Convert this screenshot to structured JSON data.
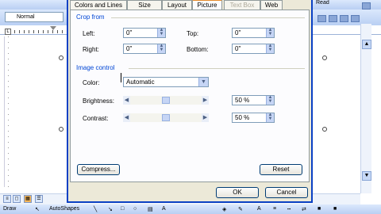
{
  "word": {
    "style_value": "Normal",
    "read_label": "Read",
    "ruler_tab_label": "L"
  },
  "dialog": {
    "tabs": [
      {
        "label": "Colors and Lines",
        "state": "normal"
      },
      {
        "label": "Size",
        "state": "normal"
      },
      {
        "label": "Layout",
        "state": "normal"
      },
      {
        "label": "Picture",
        "state": "active"
      },
      {
        "label": "Text Box",
        "state": "disabled"
      },
      {
        "label": "Web",
        "state": "normal"
      }
    ],
    "crop": {
      "group_label": "Crop from",
      "left_label": "Left:",
      "left_value": "0\"",
      "top_label": "Top:",
      "top_value": "0\"",
      "right_label": "Right:",
      "right_value": "0\"",
      "bottom_label": "Bottom:",
      "bottom_value": "0\""
    },
    "image_control": {
      "group_label": "Image control",
      "color_label": "Color:",
      "color_value": "Automatic",
      "brightness_label": "Brightness:",
      "brightness_value": "50 %",
      "contrast_label": "Contrast:",
      "contrast_value": "50 %"
    },
    "compress_button": "Compress...",
    "reset_button": "Reset",
    "ok_button": "OK",
    "cancel_button": "Cancel"
  },
  "drawbar": {
    "draw_label": "Draw",
    "autoshapes_label": "AutoShapes"
  },
  "colors": {
    "dialog_bg": "#ece9d8",
    "accent": "#0046d5",
    "active_tab_highlight": "#e68b2c",
    "toolbar": "#dbe8fc"
  }
}
